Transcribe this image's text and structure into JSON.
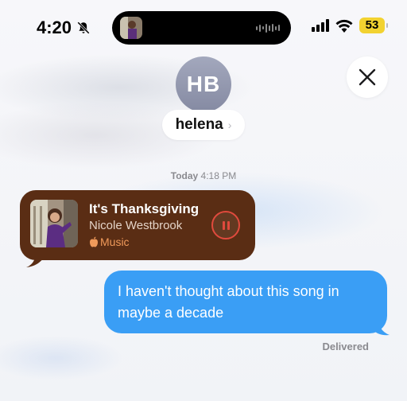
{
  "status_bar": {
    "time": "4:20",
    "battery": "53"
  },
  "contact": {
    "initials": "HB",
    "name": "helena",
    "chevron": "›"
  },
  "conversation": {
    "timestamp_day": "Today",
    "timestamp_time": "4:18 PM",
    "music_message": {
      "title": "It's Thanksgiving",
      "artist": "Nicole Westbrook",
      "service": "Music",
      "state": "playing"
    },
    "outgoing_message": "I haven't thought about this song in maybe a decade",
    "delivery_status": "Delivered"
  },
  "colors": {
    "music_bubble": "#5a2d14",
    "outgoing_bubble": "#3a9ef5",
    "pause_ring": "#e04a3d",
    "battery": "#f2d230",
    "avatar": "#9a9fb5"
  },
  "icons": {
    "mute": "bell-slash-icon",
    "close": "close-icon",
    "pause": "pause-icon",
    "apple": "apple-icon"
  }
}
